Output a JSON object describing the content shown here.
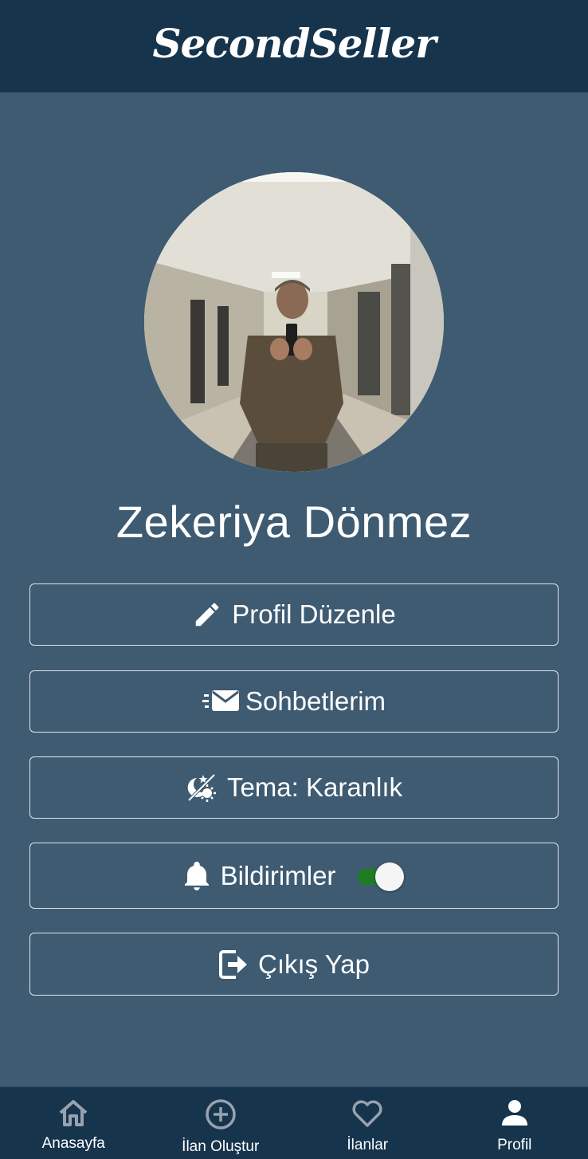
{
  "header": {
    "brand": "SecondSeller"
  },
  "profile": {
    "name": "Zekeriya Dönmez",
    "avatar_alt": "avatar"
  },
  "menu": {
    "edit_profile": {
      "label": "Profil Düzenle",
      "icon": "pencil-icon"
    },
    "chats": {
      "label": "Sohbetlerim",
      "icon": "fast-mail-icon"
    },
    "theme": {
      "label": "Tema: Karanlık",
      "icon": "theme-icon"
    },
    "notifications": {
      "label": "Bildirimler",
      "icon": "bell-icon",
      "enabled": true
    },
    "logout": {
      "label": "Çıkış Yap",
      "icon": "logout-icon"
    }
  },
  "tabs": [
    {
      "label": "Anasayfa",
      "icon": "home-icon",
      "active": false
    },
    {
      "label": "İlan Oluştur",
      "icon": "add-circle-icon",
      "active": false
    },
    {
      "label": "İlanlar",
      "icon": "heart-icon",
      "active": false
    },
    {
      "label": "Profil",
      "icon": "person-icon",
      "active": true
    }
  ],
  "colors": {
    "header_bg": "#17344d",
    "page_bg": "#3e5b72",
    "toggle_on": "#1e7d22"
  }
}
